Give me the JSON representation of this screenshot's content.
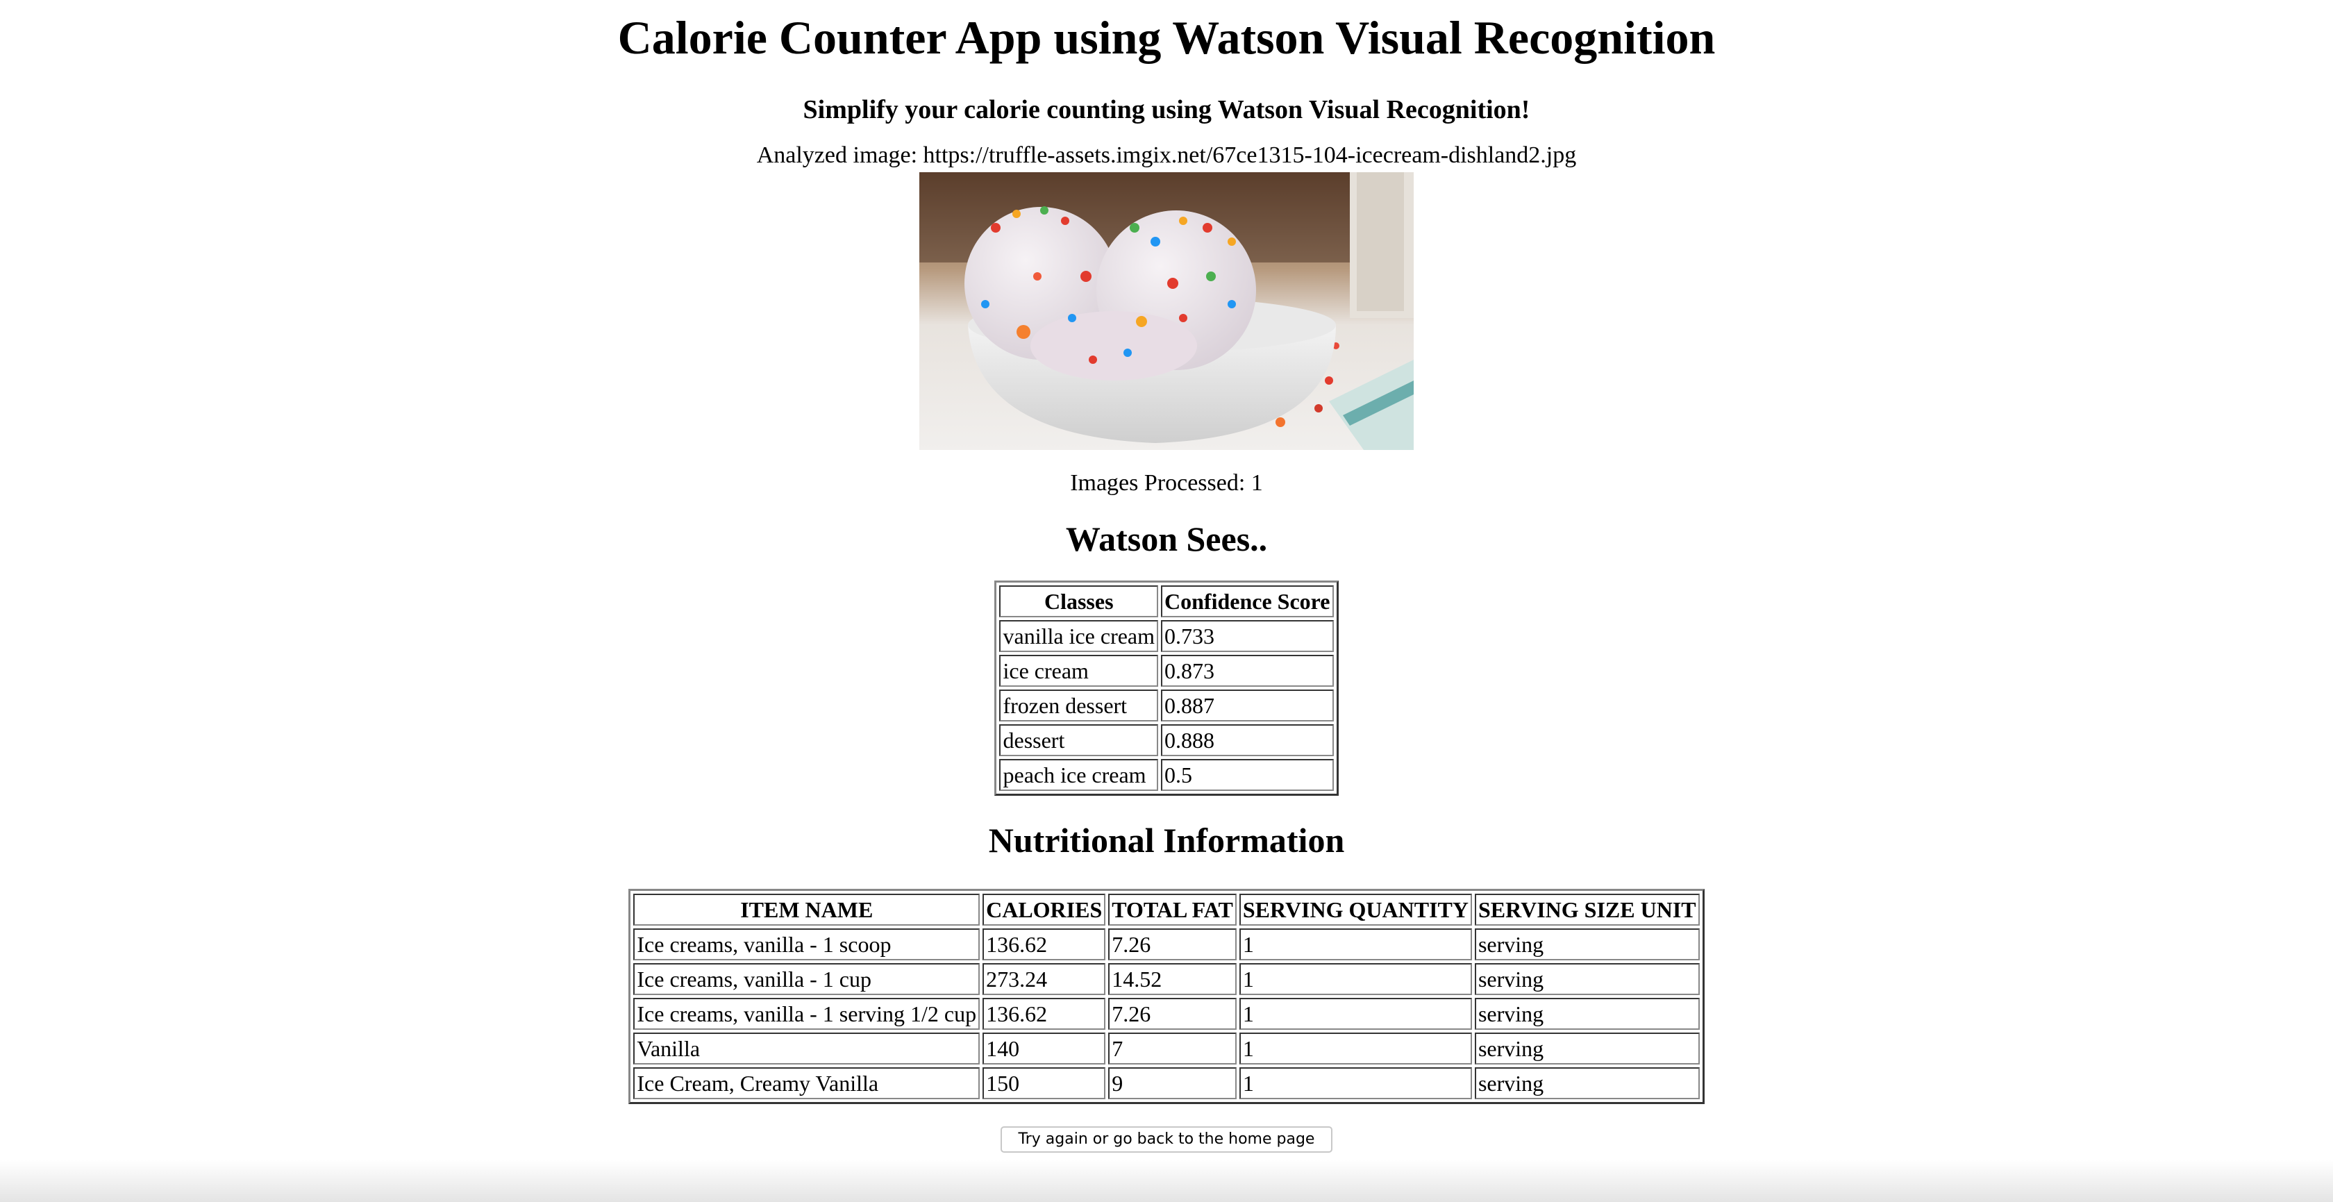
{
  "header": {
    "title": "Calorie Counter App using Watson Visual Recognition",
    "subtitle": "Simplify your calorie counting using Watson Visual Recognition!"
  },
  "analysis": {
    "analyzed_label": "Analyzed image: https://truffle-assets.imgix.net/67ce1315-104-icecream-dishland2.jpg",
    "image_icon": "ice-cream-bowl-photo",
    "processed_label": "Images Processed: 1"
  },
  "watson": {
    "heading": "Watson Sees..",
    "columns": [
      "Classes",
      "Confidence Score"
    ],
    "rows": [
      [
        "vanilla ice cream",
        "0.733"
      ],
      [
        "ice cream",
        "0.873"
      ],
      [
        "frozen dessert",
        "0.887"
      ],
      [
        "dessert",
        "0.888"
      ],
      [
        "peach ice cream",
        "0.5"
      ]
    ]
  },
  "nutrition": {
    "heading": "Nutritional Information",
    "columns": [
      "ITEM NAME",
      "CALORIES",
      "TOTAL FAT",
      "SERVING QUANTITY",
      "SERVING SIZE UNIT"
    ],
    "rows": [
      [
        "Ice creams, vanilla - 1 scoop",
        "136.62",
        "7.26",
        "1",
        "serving"
      ],
      [
        "Ice creams, vanilla - 1 cup",
        "273.24",
        "14.52",
        "1",
        "serving"
      ],
      [
        "Ice creams, vanilla - 1 serving 1/2 cup",
        "136.62",
        "7.26",
        "1",
        "serving"
      ],
      [
        "Vanilla",
        "140",
        "7",
        "1",
        "serving"
      ],
      [
        "Ice Cream, Creamy Vanilla",
        "150",
        "9",
        "1",
        "serving"
      ]
    ]
  },
  "actions": {
    "back_label": "Try again or go back to the home page"
  }
}
